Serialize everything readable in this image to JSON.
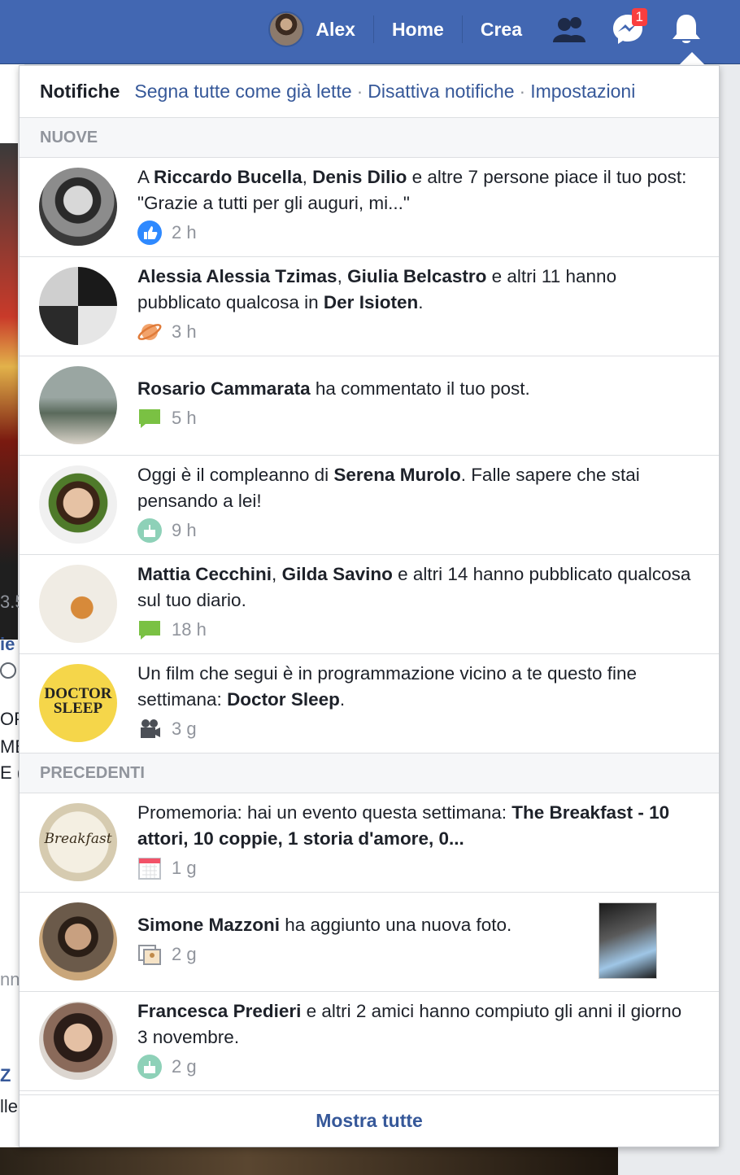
{
  "nav": {
    "user_name": "Alex",
    "home": "Home",
    "create": "Crea",
    "messenger_badge": "1"
  },
  "panel": {
    "title": "Notifiche",
    "mark_all_read": "Segna tutte come già lette",
    "disable": "Disattiva notifiche",
    "settings": "Impostazioni",
    "separator": "·",
    "section_new": "NUOVE",
    "section_previous": "PRECEDENTI",
    "show_all": "Mostra tutte"
  },
  "left_fragments": [
    "3.5",
    "ie",
    "OP",
    "MB",
    "E (",
    "nn",
    "Z",
    "lle"
  ],
  "notifications": {
    "n1": {
      "t1": "A ",
      "s1": "Riccardo Bucella",
      "t2": ", ",
      "s2": "Denis Dilio",
      "t3": " e altre 7 persone piace il tuo post: \"Grazie a tutti per gli auguri, mi...\"",
      "time": "2 h",
      "icon": "like-icon"
    },
    "n2": {
      "s1": "Alessia Alessia Tzimas",
      "t1": ", ",
      "s2": "Giulia Belcastro",
      "t2": " e altri 11 hanno pubblicato qualcosa in ",
      "s3": "Der Isioten",
      "t3": ".",
      "time": "3 h",
      "icon": "group-planet-icon"
    },
    "n3": {
      "s1": "Rosario Cammarata",
      "t1": " ha commentato il tuo post.",
      "time": "5 h",
      "icon": "comment-icon"
    },
    "n4": {
      "t1": "Oggi è il compleanno di ",
      "s1": "Serena Murolo",
      "t2": ". Falle sapere che stai pensando a lei!",
      "time": "9 h",
      "icon": "birthday-cake-icon"
    },
    "n5": {
      "s1": "Mattia Cecchini",
      "t1": ", ",
      "s2": "Gilda Savino",
      "t2": " e altri 14 hanno pubblicato qualcosa sul tuo diario.",
      "time": "18 h",
      "icon": "comment-icon"
    },
    "n6": {
      "t1": "Un film che segui è in programmazione vicino a te questo fine settimana: ",
      "s1": "Doctor Sleep",
      "t2": ".",
      "time": "3 g",
      "icon": "movie-camera-icon",
      "avatar_text_1": "DOCTOR",
      "avatar_text_2": "SLEEP"
    },
    "n7": {
      "t1": "Promemoria: hai un evento questa settimana: ",
      "s1": "The Breakfast - 10 attori, 10 coppie, 1 storia d'amore, 0...",
      "time": "1 g",
      "icon": "calendar-icon",
      "avatar_text": "Breakfast"
    },
    "n8": {
      "s1": "Simone Mazzoni",
      "t1": " ha aggiunto una nuova foto.",
      "time": "2 g",
      "icon": "photo-icon"
    },
    "n9": {
      "s1": "Francesca Predieri",
      "t1": " e altri 2 amici hanno compiuto gli anni il giorno 3 novembre.",
      "time": "2 g",
      "icon": "birthday-cake-icon"
    }
  },
  "colors": {
    "brand_blue": "#4267b2",
    "link_blue": "#365899",
    "badge_red": "#fa3e3e",
    "comment_green": "#7ac143",
    "birthday_teal": "#8ed1b8"
  }
}
